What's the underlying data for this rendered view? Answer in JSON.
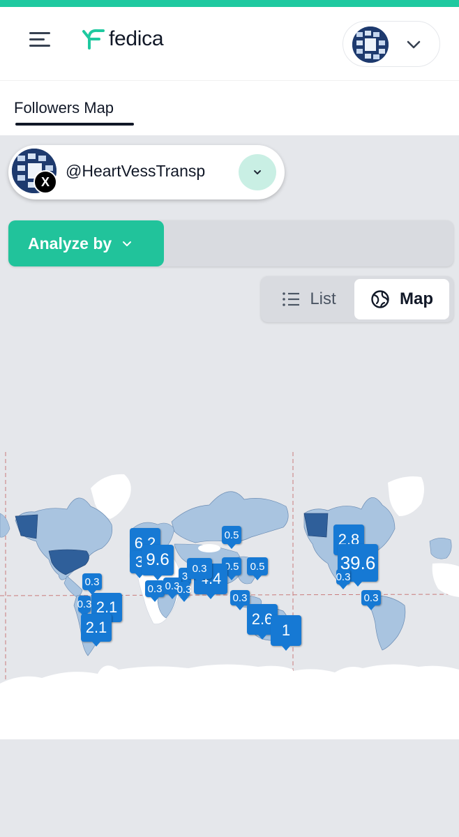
{
  "app": {
    "name": "fedica"
  },
  "header": {
    "menu_icon": "hamburger-menu-icon",
    "account_chevron_icon": "chevron-down-icon"
  },
  "tabs": [
    {
      "label": "Followers Map",
      "active": true
    }
  ],
  "account_selector": {
    "handle": "@HeartVessTransp",
    "network_badge": "X"
  },
  "analyze": {
    "label": "Analyze by"
  },
  "view_toggle": {
    "list_label": "List",
    "map_label": "Map",
    "selected": "Map"
  },
  "colors": {
    "accent": "#1fc9a0",
    "analyze_button": "#21c39b",
    "marker": "#1679d4",
    "map_land_light": "#a9c4e0",
    "map_land_dark": "#2f5f9a"
  },
  "map_markers": [
    {
      "label": "6.2"
    },
    {
      "label": "3"
    },
    {
      "label": "9.6"
    },
    {
      "label": "0.5"
    },
    {
      "label": "0.5"
    },
    {
      "label": "0.5"
    },
    {
      "label": "4.4"
    },
    {
      "label": "3"
    },
    {
      "label": "0.3"
    },
    {
      "label": "0.3"
    },
    {
      "label": "0.3"
    },
    {
      "label": "0.3"
    },
    {
      "label": "0.3"
    },
    {
      "label": "0.3"
    },
    {
      "label": "2.1"
    },
    {
      "label": "2.1"
    },
    {
      "label": "0.3"
    },
    {
      "label": "2.6"
    },
    {
      "label": "1"
    },
    {
      "label": "2.8"
    },
    {
      "label": "39.6"
    },
    {
      "label": "0.3"
    },
    {
      "label": "0.3"
    }
  ]
}
